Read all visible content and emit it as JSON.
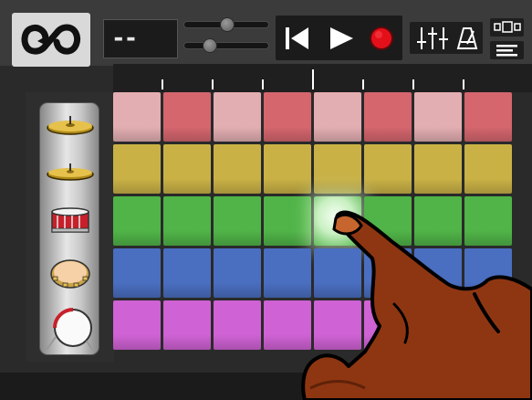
{
  "toolbar": {
    "lcd_text": "--",
    "icons": [
      "loop-logo-icon",
      "skip-back-icon",
      "play-icon",
      "record-icon",
      "mixer-icon",
      "metronome-icon",
      "view-toggle-icon",
      "menu-icon"
    ],
    "record_color": "#e3101a"
  },
  "pattern_grid": {
    "columns": 8,
    "rows": [
      {
        "instrument": "crash-cymbal-icon",
        "color": "#e3aeb2",
        "alt_color": "#d5666e"
      },
      {
        "instrument": "hi-hat-icon",
        "color": "#c9b146",
        "alt_color": "#c9b146"
      },
      {
        "instrument": "snare-drum-icon",
        "color": "#50b448",
        "alt_color": "#50b448"
      },
      {
        "instrument": "tambourine-icon",
        "color": "#4a6ec0",
        "alt_color": "#4a6ec0"
      },
      {
        "instrument": "kick-drum-icon",
        "color": "#cf62d4",
        "alt_color": "#cf62d4"
      }
    ],
    "active_cell": {
      "row": 2,
      "col": 4
    },
    "playhead_column": 4
  }
}
